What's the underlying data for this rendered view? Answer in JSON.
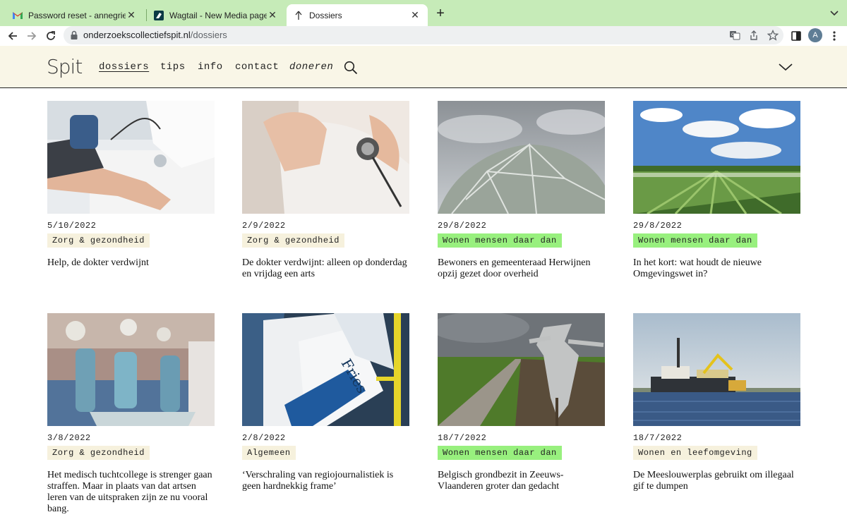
{
  "browser": {
    "tabs": [
      {
        "title": "Password reset - annegrietje@",
        "icon": "gmail-icon"
      },
      {
        "title": "Wagtail - New Media page",
        "icon": "wagtail-icon"
      },
      {
        "title": "Dossiers",
        "icon": "spit-favicon-icon",
        "active": true
      }
    ],
    "url_host": "onderzoekscollectiefspit.nl",
    "url_path": "/dossiers",
    "profile_initial": "A"
  },
  "site": {
    "logo": "Spit",
    "nav": {
      "dossiers": "dossiers",
      "tips": "tips",
      "info": "info",
      "contact": "contact",
      "doneren": "doneren"
    },
    "colors": {
      "header_bg": "#f9f6e7",
      "tag_default": "#f6f1dd",
      "tag_green": "#98f07e"
    }
  },
  "dossiers": [
    {
      "date": "5/10/2022",
      "tag": "Zorg & gezondheid",
      "tag_style": "default",
      "headline": "Help, de dokter verdwijnt",
      "image": "blood-pressure-photo"
    },
    {
      "date": "2/9/2022",
      "tag": "Zorg & gezondheid",
      "tag_style": "default",
      "headline": "De dokter verdwijnt: alleen op donderdag en vrijdag een arts",
      "image": "stethoscope-photo"
    },
    {
      "date": "29/8/2022",
      "tag": "Wonen mensen daar dan",
      "tag_style": "green",
      "headline": "Bewoners en gemeenteraad Herwijnen opzij gezet door overheid",
      "image": "dome-photo"
    },
    {
      "date": "29/8/2022",
      "tag": "Wonen mensen daar dan",
      "tag_style": "green",
      "headline": "In het kort: wat houdt de nieuwe Omgevingswet in?",
      "image": "orchard-photo"
    },
    {
      "date": "3/8/2022",
      "tag": "Zorg & gezondheid",
      "tag_style": "default",
      "headline": "Het medisch tuchtcollege is strenger gaan straffen. Maar in plaats van dat artsen leren van de uitspraken zijn ze nu vooral bang.",
      "image": "operating-room-photo"
    },
    {
      "date": "2/8/2022",
      "tag": "Algemeen",
      "tag_style": "default",
      "headline": "‘Verschraling van regiojournalistiek is geen hardnekkig frame’",
      "image": "newspapers-photo"
    },
    {
      "date": "18/7/2022",
      "tag": "Wonen mensen daar dan",
      "tag_style": "green",
      "headline": "Belgisch grondbezit in Zeeuws-Vlaanderen groter dan gedacht",
      "image": "scarecrow-photo"
    },
    {
      "date": "18/7/2022",
      "tag": "Wonen en leefomgeving",
      "tag_style": "default",
      "headline": "De Meeslouwerplas gebruikt om illegaal gif te dumpen",
      "image": "dredger-photo"
    }
  ]
}
